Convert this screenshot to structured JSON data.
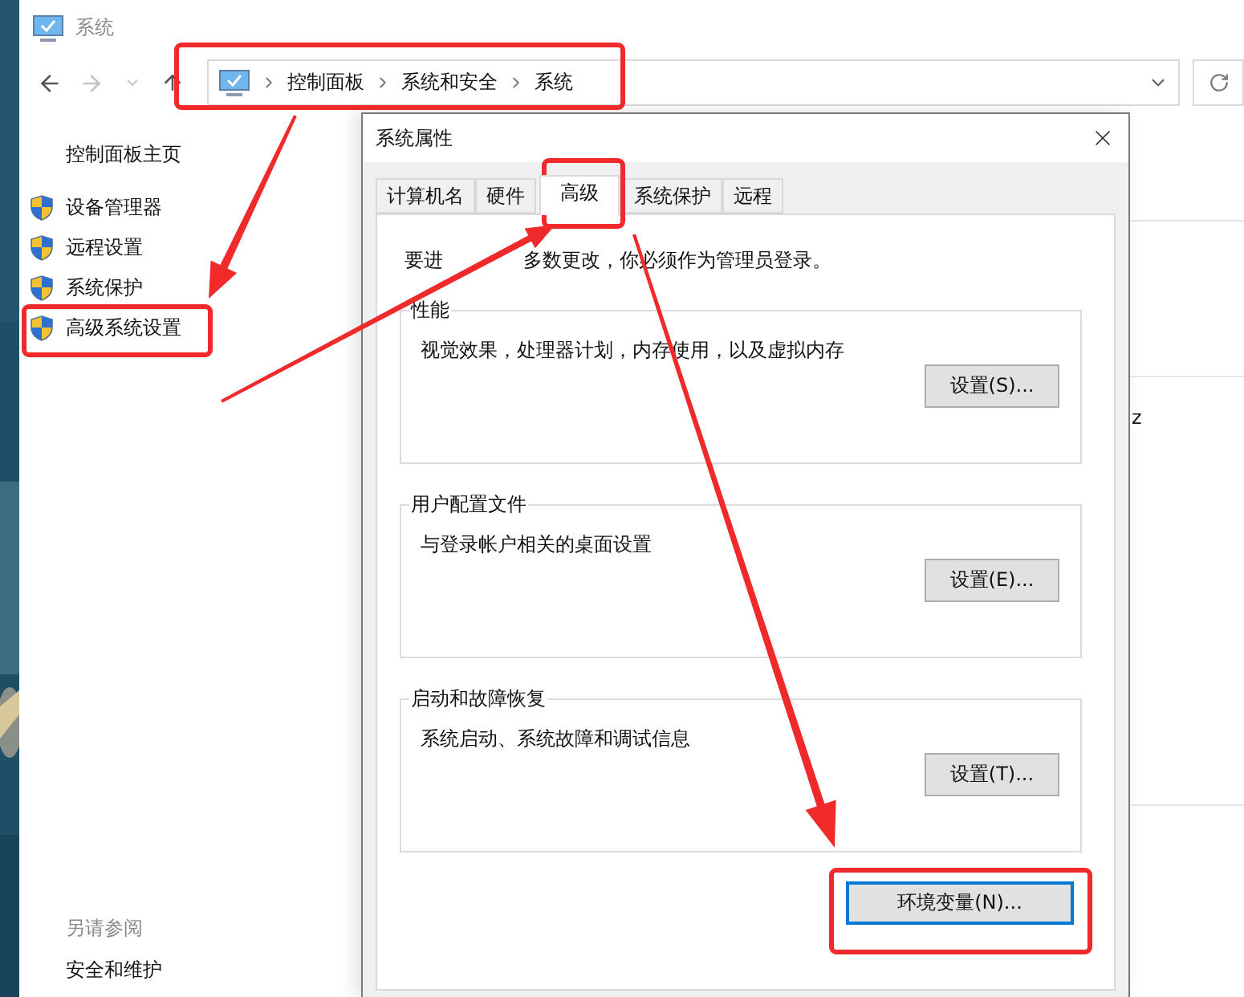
{
  "window": {
    "title": "系统"
  },
  "nav": {
    "back_enabled": true,
    "forward_enabled": false,
    "breadcrumb": [
      "控制面板",
      "系统和安全",
      "系统"
    ]
  },
  "sidebar": {
    "home": "控制面板主页",
    "items": [
      {
        "label": "设备管理器"
      },
      {
        "label": "远程设置"
      },
      {
        "label": "系统保护"
      },
      {
        "label": "高级系统设置"
      }
    ],
    "see_also": {
      "heading": "另请参阅",
      "links": [
        "安全和维护"
      ]
    }
  },
  "background": {
    "fragment": "z"
  },
  "dialog": {
    "title": "系统属性",
    "tabs": [
      {
        "label": "计算机名",
        "selected": false
      },
      {
        "label": "硬件",
        "selected": false
      },
      {
        "label": "高级",
        "selected": true
      },
      {
        "label": "系统保护",
        "selected": false
      },
      {
        "label": "远程",
        "selected": false
      }
    ],
    "notice_parts": [
      "要进",
      "多数更改，你必须作为管理员登录。"
    ],
    "groups": [
      {
        "title": "性能",
        "description": "视觉效果，处理器计划，内存使用，以及虚拟内存",
        "button": "设置(S)..."
      },
      {
        "title": "用户配置文件",
        "description": "与登录帐户相关的桌面设置",
        "button": "设置(E)..."
      },
      {
        "title": "启动和故障恢复",
        "description": "系统启动、系统故障和调试信息",
        "button": "设置(T)..."
      }
    ],
    "env_button": {
      "label": "环境变量(N)...",
      "focused": true
    }
  }
}
